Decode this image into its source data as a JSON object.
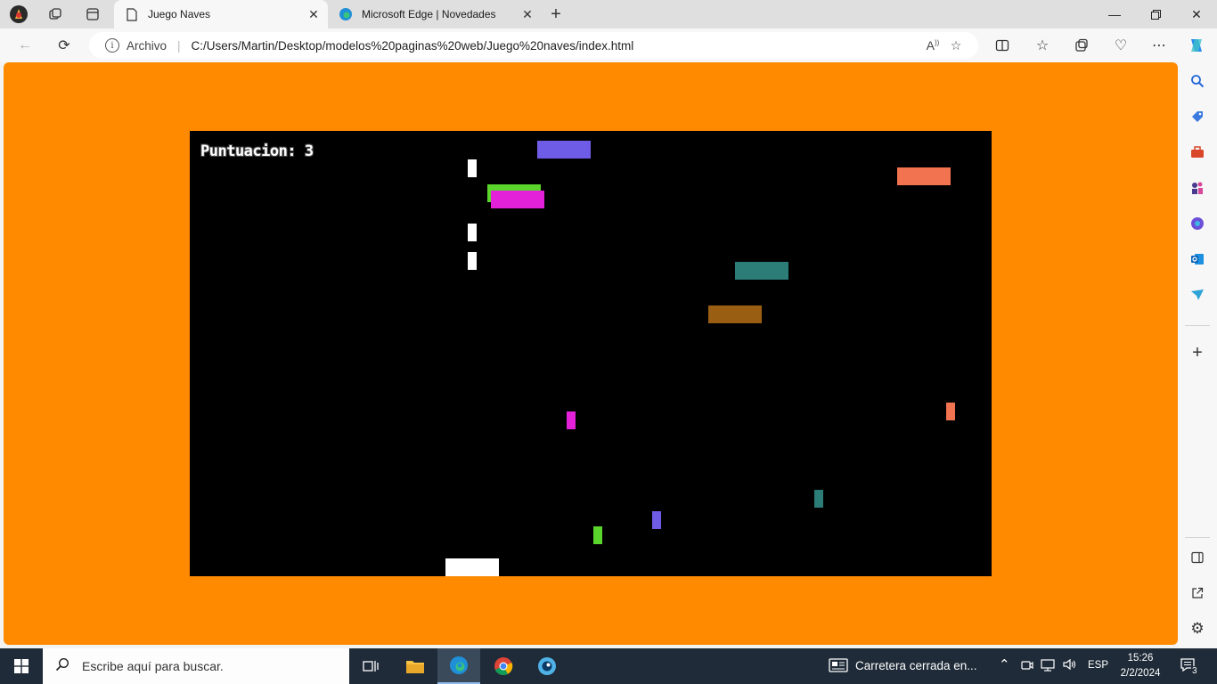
{
  "browser": {
    "tabs": [
      {
        "title": "Juego Naves",
        "active": true
      },
      {
        "title": "Microsoft Edge | Novedades",
        "active": false
      }
    ],
    "address": {
      "protocol_label": "Archivo",
      "url": "C:/Users/Martin/Desktop/modelos%20paginas%20web/Juego%20naves/index.html"
    },
    "colors": {
      "tab_strip": "#dfdfdf",
      "toolbar": "#f7f7f7"
    }
  },
  "page": {
    "background": "#ff8a00",
    "game": {
      "score_label": "Puntuacion: 3",
      "background": "#000000",
      "enemy_colors": [
        "#6f5ce6",
        "#f2734f",
        "#5ad52c",
        "#e321d8",
        "#2c7d78",
        "#9a5e12"
      ],
      "player_color": "#ffffff"
    }
  },
  "taskbar": {
    "search_placeholder": "Escribe aquí para buscar.",
    "news_text": "Carretera cerrada en...",
    "language": "ESP",
    "time": "15:26",
    "date": "2/2/2024",
    "notification_count": "3"
  }
}
